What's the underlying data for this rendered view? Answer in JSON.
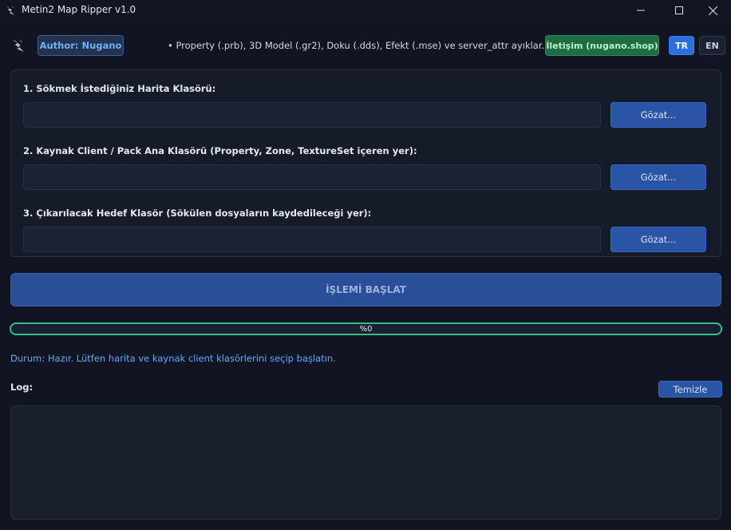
{
  "window": {
    "title": "Metin2 Map Ripper v1.0",
    "min_icon": "minimize-icon",
    "max_icon": "maximize-icon",
    "close_icon": "close-icon"
  },
  "header": {
    "author": "Author: Nugano",
    "info": "• Property (.prb), 3D Model (.gr2), Doku (.dds), Efekt (.mse) ve server_attr ayıklar.",
    "contact": "İletişim (nugano.shop)",
    "lang_tr": "TR",
    "lang_en": "EN",
    "active_lang": "TR"
  },
  "fields": [
    {
      "label": "1. Sökmek İstediğiniz Harita Klasörü:",
      "value": "",
      "button": "Gözat..."
    },
    {
      "label": "2. Kaynak Client / Pack Ana Klasörü (Property, Zone, TextureSet içeren yer):",
      "value": "",
      "button": "Gözat..."
    },
    {
      "label": "3. Çıkarılacak Hedef Klasör (Sökülen dosyaların kaydedileceği yer):",
      "value": "",
      "button": "Gözat..."
    }
  ],
  "start_button": "İŞLEMİ BAŞLAT",
  "progress": {
    "value": 0,
    "text": "%0"
  },
  "status": "Durum: Hazır. Lütfen harita ve kaynak client klasörlerini seçip başlatın.",
  "log": {
    "label": "Log:",
    "clear_button": "Temizle",
    "content": ""
  },
  "colors": {
    "background": "#111522",
    "accent_blue": "#2a55a6",
    "progress_green": "#2fc08a",
    "status_blue": "#5fa8ff",
    "contact_green": "#1f6b43"
  }
}
